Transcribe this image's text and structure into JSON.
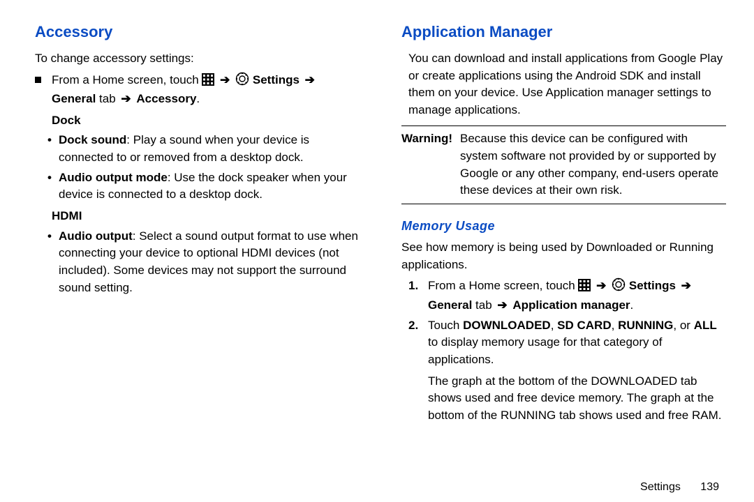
{
  "left": {
    "title": "Accessory",
    "intro": "To change accessory settings:",
    "step_prefix": "From a Home screen, touch ",
    "settings_label": "Settings",
    "nav_general": "General",
    "nav_tab": " tab ",
    "nav_accessory": "Accessory",
    "dock_head": "Dock",
    "dock_sound_label": "Dock sound",
    "dock_sound_text": ": Play a sound when your device is connected to or removed from a desktop dock.",
    "audio_output_mode_label": "Audio output mode",
    "audio_output_mode_text": ": Use the dock speaker when your device is connected to a desktop dock.",
    "hdmi_head": "HDMI",
    "audio_output_label": "Audio output",
    "audio_output_text": ": Select a sound output format to use when connecting your device to optional HDMI devices (not included). Some devices may not support the surround sound setting."
  },
  "right": {
    "title": "Application Manager",
    "intro": "You can download and install applications from Google Play or create applications using the Android SDK and install them on your device. Use Application manager settings to manage applications.",
    "warning_label": "Warning!",
    "warning_text": "Because this device can be configured with system software not provided by or supported by Google or any other company, end-users operate these devices at their own risk.",
    "memory_title": "Memory Usage",
    "memory_intro": "See how memory is being used by Downloaded or Running applications.",
    "step1_num": "1.",
    "step1_prefix": "From a Home screen, touch ",
    "settings_label": "Settings",
    "nav_general": "General",
    "nav_tab": " tab ",
    "nav_appmgr": "Application manager",
    "step2_num": "2.",
    "step2_a": "Touch ",
    "step2_dl": "DOWNLOADED",
    "step2_sep1": ", ",
    "step2_sd": "SD CARD",
    "step2_sep2": ", ",
    "step2_run": "RUNNING",
    "step2_sep3": ", or ",
    "step2_all": "ALL",
    "step2_b": " to display memory usage for that category of applications.",
    "graph_text": "The graph at the bottom of the DOWNLOADED tab shows used and free device memory. The graph at the bottom of the RUNNING tab shows used and free RAM."
  },
  "footer": {
    "chapter": "Settings",
    "page": "139"
  }
}
